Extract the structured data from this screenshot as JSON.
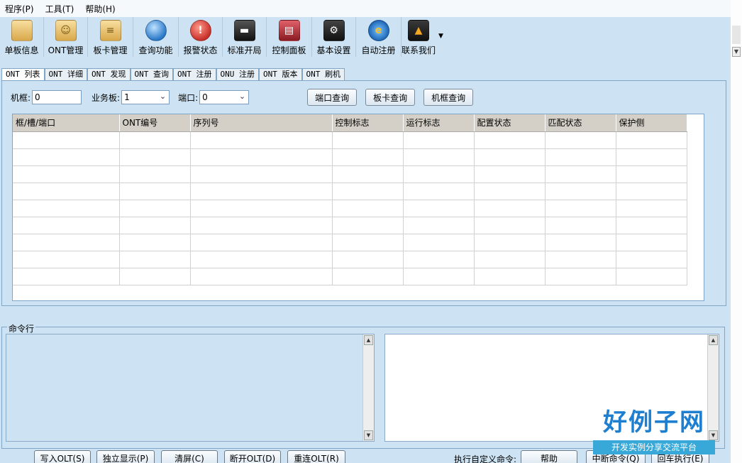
{
  "menu": [
    "程序(P)",
    "工具(T)",
    "帮助(H)"
  ],
  "toolbar": [
    {
      "label": "单板信息",
      "icon": "folder-icon",
      "glyph": ""
    },
    {
      "label": "ONT管理",
      "icon": "folder-icon",
      "glyph": "☺"
    },
    {
      "label": "板卡管理",
      "icon": "folder-icon",
      "glyph": "≡"
    },
    {
      "label": "查询功能",
      "icon": "search-globe-icon",
      "glyph": ""
    },
    {
      "label": "报警状态",
      "icon": "alarm-icon",
      "glyph": "!"
    },
    {
      "label": "标准开局",
      "icon": "terminal-icon",
      "glyph": "▬"
    },
    {
      "label": "控制面板",
      "icon": "control-panel-icon",
      "glyph": "▤"
    },
    {
      "label": "基本设置",
      "icon": "gear-icon",
      "glyph": "⚙"
    },
    {
      "label": "自动注册",
      "icon": "ie-browser-icon",
      "glyph": "e"
    },
    {
      "label": "联系我们",
      "icon": "cone-icon",
      "glyph": "▲"
    }
  ],
  "tabs": [
    "ONT 列表",
    "ONT 详细",
    "ONT 发现",
    "ONT 查询",
    "ONT 注册",
    "ONU 注册",
    "ONT 版本",
    "ONT 刷机"
  ],
  "filters": {
    "frame_label": "机框:",
    "frame_value": "0",
    "board_label": "业务板:",
    "board_value": "1",
    "port_label": "端口:",
    "port_value": "0",
    "btn_port_query": "端口查询",
    "btn_board_query": "板卡查询",
    "btn_frame_query": "机框查询"
  },
  "table": {
    "columns": [
      "框/槽/端口",
      "ONT编号",
      "序列号",
      "控制标志",
      "运行标志",
      "配置状态",
      "匹配状态",
      "保护侧"
    ],
    "rows": 9
  },
  "command": {
    "legend": "命令行"
  },
  "bottom": {
    "write_olt": "写入OLT(S)",
    "standalone": "独立显示(P)",
    "clear": "清屏(C)",
    "disconnect": "断开OLT(D)",
    "reconnect": "重连OLT(R)",
    "custom_cmd_label": "执行自定义命令:",
    "help": "帮助",
    "interrupt": "中断命令(Q)",
    "enter_exec": "回车执行(E)"
  },
  "watermark": {
    "title": "好例子网",
    "subtitle": "开发实例分享交流平台"
  }
}
